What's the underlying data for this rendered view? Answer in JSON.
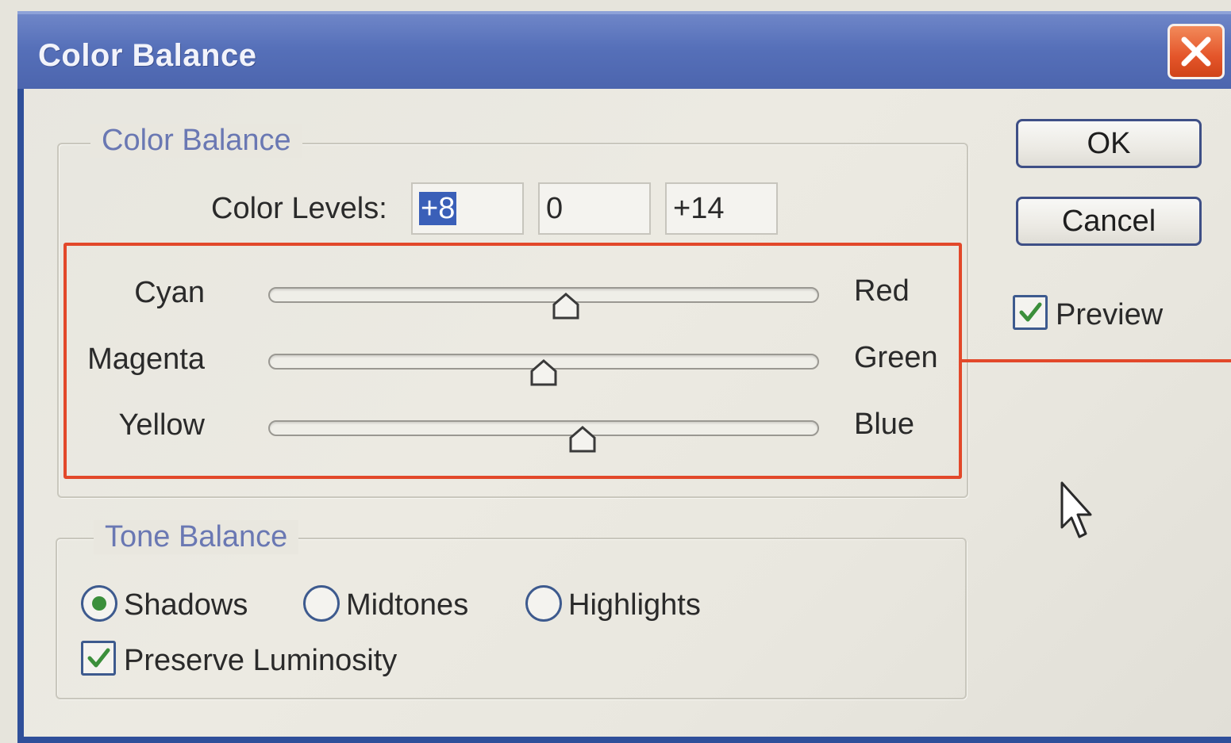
{
  "window": {
    "title": "Color Balance",
    "close_icon": "close-icon"
  },
  "color_balance": {
    "group_title": "Color Balance",
    "color_levels_label": "Color Levels:",
    "levels": [
      "+8",
      "0",
      "+14"
    ],
    "sliders": [
      {
        "left_label": "Cyan",
        "right_label": "Red",
        "value": 8,
        "min": -100,
        "max": 100
      },
      {
        "left_label": "Magenta",
        "right_label": "Green",
        "value": 0,
        "min": -100,
        "max": 100
      },
      {
        "left_label": "Yellow",
        "right_label": "Blue",
        "value": 14,
        "min": -100,
        "max": 100
      }
    ],
    "highlight_color": "#e2482a"
  },
  "tone_balance": {
    "group_title": "Tone Balance",
    "options": [
      {
        "label": "Shadows",
        "selected": true
      },
      {
        "label": "Midtones",
        "selected": false
      },
      {
        "label": "Highlights",
        "selected": false
      }
    ],
    "preserve_luminosity": {
      "label": "Preserve Luminosity",
      "checked": true
    }
  },
  "buttons": {
    "ok": "OK",
    "cancel": "Cancel"
  },
  "preview": {
    "label": "Preview",
    "checked": true
  },
  "colors": {
    "titlebar": "#5670b9",
    "group_title": "#6a78b3",
    "close_button": "#e4552a",
    "check_mark": "#3b8f3b"
  }
}
